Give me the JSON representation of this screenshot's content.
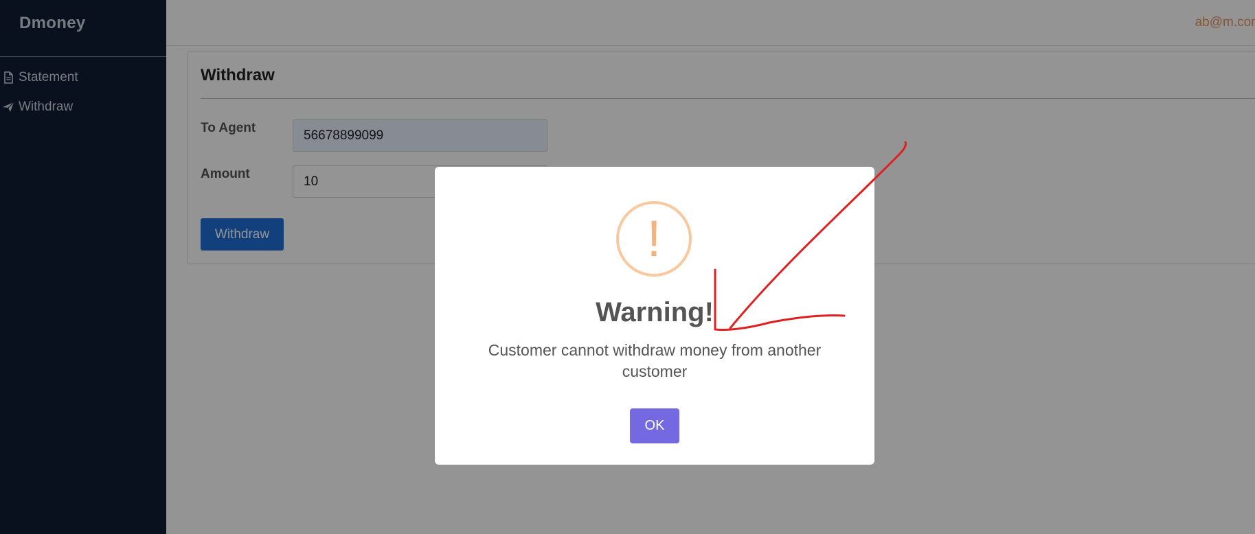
{
  "app": {
    "brand": "Dmoney"
  },
  "sidebar": {
    "items": [
      {
        "label": "Statement",
        "icon": "file-icon"
      },
      {
        "label": "Withdraw",
        "icon": "paper-plane-icon"
      }
    ]
  },
  "header": {
    "user_email": "ab@m.com"
  },
  "form": {
    "title": "Withdraw",
    "agent_label": "To Agent",
    "agent_value": "56678899099",
    "amount_label": "Amount",
    "amount_value": "10",
    "submit_label": "Withdraw"
  },
  "modal": {
    "icon": "warning-icon",
    "glyph": "!",
    "title": "Warning!",
    "message": "Customer cannot withdraw money from another customer",
    "ok_label": "OK"
  },
  "colors": {
    "sidebar_bg": "#0f1e33",
    "primary_button": "#1f6fd6",
    "modal_button": "#7469e0",
    "warning": "#f8c99f",
    "annotation_stroke": "#e02020"
  }
}
